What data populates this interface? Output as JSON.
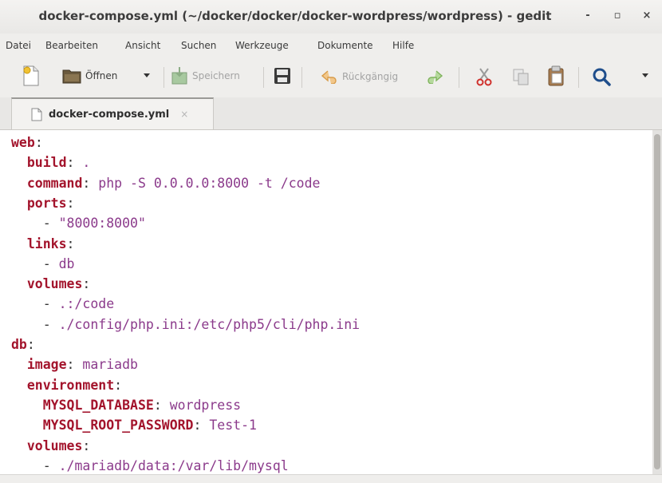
{
  "window": {
    "title": "docker-compose.yml (~/docker/docker/docker-wordpress/wordpress) - gedit",
    "minimize": "-",
    "maximize": "▫",
    "close": "×"
  },
  "menu": [
    "Datei",
    "Bearbeiten",
    "Ansicht",
    "Suchen",
    "Werkzeuge",
    "Dokumente",
    "Hilfe"
  ],
  "toolbar": {
    "open_label": "Öffnen",
    "save_label": "Speichern",
    "undo_label": "Rückgängig",
    "icons": [
      "new-document-icon",
      "open-folder-icon",
      "dropdown-arrow-icon",
      "save-icon",
      "save-as-icon",
      "undo-icon",
      "redo-icon",
      "cut-icon",
      "copy-icon",
      "paste-icon",
      "search-icon",
      "menu-arrow-icon"
    ]
  },
  "tab": {
    "label": "docker-compose.yml",
    "close": "×"
  },
  "editor": {
    "lines": [
      {
        "key": "web",
        "sep": ":",
        "value": "",
        "indent": ""
      },
      {
        "key": "build",
        "sep": ":",
        "value": " .",
        "indent": "  "
      },
      {
        "key": "command",
        "sep": ":",
        "value": " php -S 0.0.0.0:8000 -t /code",
        "indent": "  "
      },
      {
        "key": "ports",
        "sep": ":",
        "value": "",
        "indent": "  "
      },
      {
        "key": "",
        "sep": "- ",
        "value": "\"8000:8000\"",
        "indent": "    "
      },
      {
        "key": "links",
        "sep": ":",
        "value": "",
        "indent": "  "
      },
      {
        "key": "",
        "sep": "- ",
        "value": "db",
        "indent": "    "
      },
      {
        "key": "volumes",
        "sep": ":",
        "value": "",
        "indent": "  "
      },
      {
        "key": "",
        "sep": "- ",
        "value": ".:/code",
        "indent": "    "
      },
      {
        "key": "",
        "sep": "- ",
        "value": "./config/php.ini:/etc/php5/cli/php.ini",
        "indent": "    "
      },
      {
        "key": "db",
        "sep": ":",
        "value": "",
        "indent": ""
      },
      {
        "key": "image",
        "sep": ":",
        "value": " mariadb",
        "indent": "  "
      },
      {
        "key": "environment",
        "sep": ":",
        "value": "",
        "indent": "  "
      },
      {
        "key": "MYSQL_DATABASE",
        "sep": ":",
        "value": " wordpress",
        "indent": "    "
      },
      {
        "key": "MYSQL_ROOT_PASSWORD",
        "sep": ":",
        "value": " Test-1",
        "indent": "    "
      },
      {
        "key": "volumes",
        "sep": ":",
        "value": "",
        "indent": "  "
      },
      {
        "key": "",
        "sep": "- ",
        "value": "./mariadb/data:/var/lib/mysql",
        "indent": "    "
      }
    ]
  },
  "colors": {
    "key": "#a3142c",
    "value": "#8b3a8b",
    "chrome": "#efeeec"
  }
}
